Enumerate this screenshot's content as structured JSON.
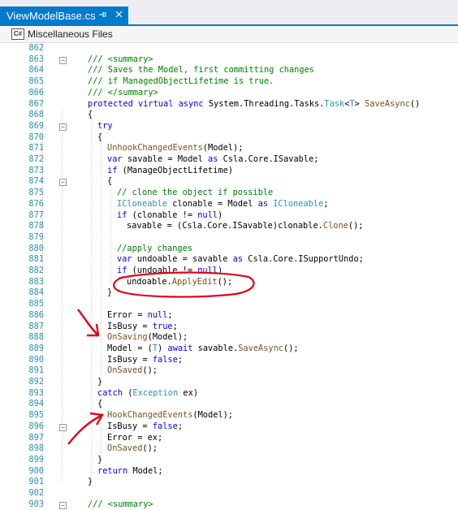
{
  "tab": {
    "title": "ViewModelBase.cs",
    "pin_icon": "pin-icon",
    "close_icon": "close-icon"
  },
  "filebar": {
    "icon": "csharp-file-icon",
    "label": "Miscellaneous Files"
  },
  "colors": {
    "accent": "#007acc",
    "line_number": "#2b91af",
    "keyword": "#0000ff",
    "comment": "#008000",
    "type": "#2b91af",
    "method": "#74531f",
    "annotation": "#e0001a"
  },
  "lines": [
    {
      "n": "862",
      "code": ""
    },
    {
      "n": "863",
      "code": "/// <summary>"
    },
    {
      "n": "864",
      "code": "/// Saves the Model, first committing changes"
    },
    {
      "n": "865",
      "code": "/// if ManagedObjectLifetime is true."
    },
    {
      "n": "866",
      "code": "/// </summary>"
    },
    {
      "n": "867",
      "code": "protected virtual async System.Threading.Tasks.Task<T> SaveAsync()"
    },
    {
      "n": "868",
      "code": "{"
    },
    {
      "n": "869",
      "code": "try"
    },
    {
      "n": "870",
      "code": "{"
    },
    {
      "n": "871",
      "code": "UnhookChangedEvents(Model);"
    },
    {
      "n": "872",
      "code": "var savable = Model as Csla.Core.ISavable;"
    },
    {
      "n": "873",
      "code": "if (ManageObjectLifetime)"
    },
    {
      "n": "874",
      "code": "{"
    },
    {
      "n": "875",
      "code": "// clone the object if possible"
    },
    {
      "n": "876",
      "code": "ICloneable clonable = Model as ICloneable;"
    },
    {
      "n": "877",
      "code": "if (clonable != null)"
    },
    {
      "n": "878",
      "code": "savable = (Csla.Core.ISavable)clonable.Clone();"
    },
    {
      "n": "879",
      "code": ""
    },
    {
      "n": "880",
      "code": "//apply changes"
    },
    {
      "n": "881",
      "code": "var undoable = savable as Csla.Core.ISupportUndo;"
    },
    {
      "n": "882",
      "code": "if (undoable != null)"
    },
    {
      "n": "883",
      "code": "undoable.ApplyEdit();"
    },
    {
      "n": "884",
      "code": "}"
    },
    {
      "n": "885",
      "code": ""
    },
    {
      "n": "886",
      "code": "Error = null;"
    },
    {
      "n": "887",
      "code": "IsBusy = true;"
    },
    {
      "n": "888",
      "code": "OnSaving(Model);"
    },
    {
      "n": "889",
      "code": "Model = (T) await savable.SaveAsync();"
    },
    {
      "n": "890",
      "code": "IsBusy = false;"
    },
    {
      "n": "891",
      "code": "OnSaved();"
    },
    {
      "n": "892",
      "code": "}"
    },
    {
      "n": "893",
      "code": "catch (Exception ex)"
    },
    {
      "n": "894",
      "code": "{"
    },
    {
      "n": "895",
      "code": "HookChangedEvents(Model);"
    },
    {
      "n": "896",
      "code": "IsBusy = false;"
    },
    {
      "n": "897",
      "code": "Error = ex;"
    },
    {
      "n": "898",
      "code": "OnSaved();"
    },
    {
      "n": "899",
      "code": "}"
    },
    {
      "n": "900",
      "code": "return Model;"
    },
    {
      "n": "901",
      "code": "}"
    },
    {
      "n": "902",
      "code": ""
    },
    {
      "n": "903",
      "code": "/// <summary>"
    }
  ]
}
